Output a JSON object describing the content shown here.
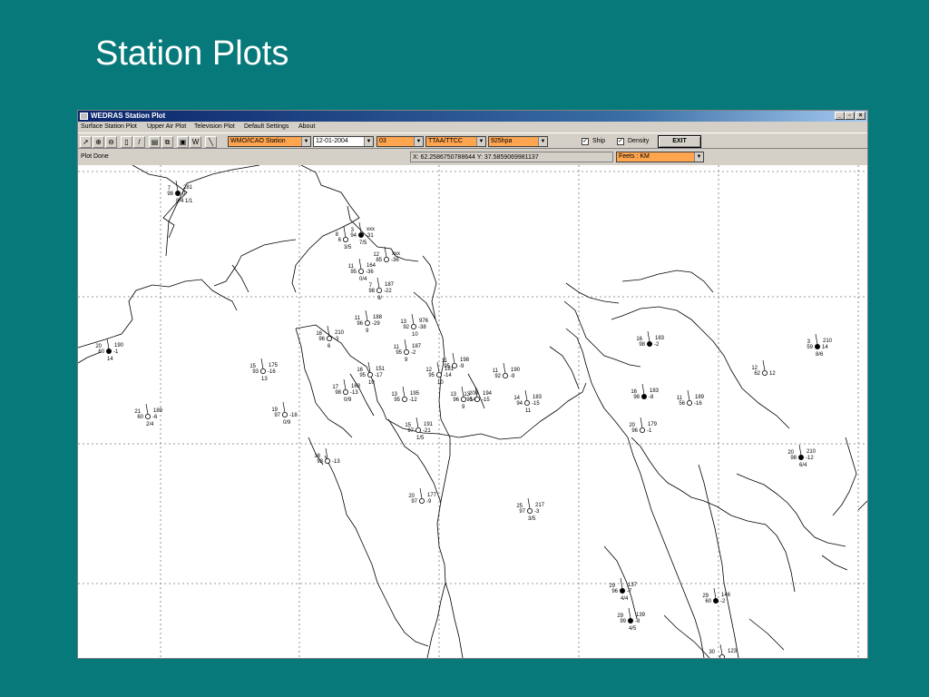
{
  "slide": {
    "title": "Station Plots"
  },
  "window": {
    "title": "WEDRAS Station Plot",
    "controls": [
      "_",
      "▫",
      "×"
    ]
  },
  "menu": [
    "Surface Station Plot",
    "Upper Air Plot",
    "Television Plot",
    "Default Settings",
    "About"
  ],
  "toolbar": {
    "tools": [
      "pointer-icon",
      "zoom-in-icon",
      "zoom-out-icon",
      "lamp-icon",
      "pencil-icon",
      "print-icon",
      "copy-icon",
      "save-icon",
      "w-icon",
      "line-icon"
    ],
    "station_type": "WMO/ICAO Station",
    "date": "12-01-2004",
    "hour": "03",
    "code": "TTAA/TTCC",
    "level": "925hpa",
    "ship_label": "Ship",
    "ship_checked": true,
    "density_label": "Density",
    "density_checked": true,
    "exit_label": "EXIT",
    "highlight_color": "#ffa54f"
  },
  "status": {
    "message": "Plot Done",
    "coords": "X: 62.2586750788644  Y: 37.5859069981137",
    "units": "Feets : KM"
  },
  "map": {
    "stations": [
      {
        "top": "7",
        "left": "98",
        "right": "0",
        "val": "281",
        "low": "8/4 1/1",
        "f": "#"
      },
      {
        "top": "3",
        "left": "94",
        "right": "-31",
        "val": "xxx",
        "low": "7/5",
        "f": "#"
      },
      {
        "top": "8",
        "left": "6",
        "right": "",
        "val": "",
        "low": "3/5",
        "f": "-"
      },
      {
        "top": "12",
        "left": "85",
        "right": "-36",
        "val": "xxx",
        "low": "",
        "f": "o"
      },
      {
        "top": "11",
        "left": "95",
        "right": "-36",
        "val": "164",
        "low": "0/4",
        "f": "o"
      },
      {
        "top": "7",
        "left": "98",
        "right": "-22",
        "val": "187",
        "low": "9/",
        "f": "o"
      },
      {
        "top": "11",
        "left": "96",
        "right": "-29",
        "val": "188",
        "low": "9",
        "f": "o"
      },
      {
        "top": "13",
        "left": "92",
        "right": "-38",
        "val": "976",
        "low": "10",
        "f": "o"
      },
      {
        "top": "16",
        "left": "96",
        "right": "-3",
        "val": "210",
        "low": "6",
        "f": "o"
      },
      {
        "top": "20",
        "left": "60",
        "right": "-1",
        "val": "190",
        "low": "14",
        "f": "#"
      },
      {
        "top": "15",
        "left": "93",
        "right": "-16",
        "val": "175",
        "low": "13",
        "f": "o"
      },
      {
        "top": "16",
        "left": "95",
        "right": "-17",
        "val": "151",
        "low": "10",
        "f": "o"
      },
      {
        "top": "11",
        "left": "95",
        "right": "-2",
        "val": "187",
        "low": "9",
        "f": "o"
      },
      {
        "top": "11",
        "left": "95",
        "right": "-9",
        "val": "198",
        "low": "",
        "f": "o"
      },
      {
        "top": "12",
        "left": "95",
        "right": "-14",
        "val": "181",
        "low": "10",
        "f": "o"
      },
      {
        "top": "11",
        "left": "92",
        "right": "-9",
        "val": "190",
        "low": "",
        "f": "o"
      },
      {
        "top": "17",
        "left": "98",
        "right": "-13",
        "val": "163",
        "low": "0/9",
        "f": "o"
      },
      {
        "top": "13",
        "left": "95",
        "right": "-12",
        "val": "195",
        "low": "",
        "f": "o"
      },
      {
        "top": "13",
        "left": "96",
        "right": "-14",
        "val": "200",
        "low": "9",
        "f": "o"
      },
      {
        "top": "13",
        "left": "95",
        "right": "-15",
        "val": "194",
        "low": "",
        "f": "o"
      },
      {
        "top": "14",
        "left": "94",
        "right": "-15",
        "val": "183",
        "low": "11",
        "f": "o"
      },
      {
        "top": "21",
        "left": "60",
        "right": "-6",
        "val": "189",
        "low": "2/4",
        "f": "o"
      },
      {
        "top": "19",
        "left": "97",
        "right": "-18",
        "val": "",
        "low": "0/9",
        "f": "o"
      },
      {
        "top": "15",
        "left": "97",
        "right": "-21",
        "val": "191",
        "low": "1/5",
        "f": "o"
      },
      {
        "top": "18",
        "left": "93",
        "right": "-13",
        "val": "",
        "low": "",
        "f": "o"
      },
      {
        "top": "20",
        "left": "97",
        "right": "-9",
        "val": "177",
        "low": "",
        "f": "o"
      },
      {
        "top": "25",
        "left": "97",
        "right": "-3",
        "val": "217",
        "low": "3/5",
        "f": "o"
      },
      {
        "top": "16",
        "left": "98",
        "right": "-8",
        "val": "183",
        "low": "",
        "f": "#"
      },
      {
        "top": "20",
        "left": "96",
        "right": "-1",
        "val": "179",
        "low": "",
        "f": "o"
      },
      {
        "top": "20",
        "left": "98",
        "right": "-12",
        "val": "210",
        "low": "6/4",
        "f": "#"
      },
      {
        "top": "3",
        "left": "59",
        "right": "14",
        "val": "210",
        "low": "8/6",
        "f": "#"
      },
      {
        "top": "12",
        "left": "62",
        "right": "12",
        "val": "",
        "low": "",
        "f": "o"
      },
      {
        "top": "16",
        "left": "98",
        "right": "-2",
        "val": "183",
        "low": "",
        "f": "#"
      },
      {
        "top": "11",
        "left": "56",
        "right": "-16",
        "val": "189",
        "low": "",
        "f": "o"
      },
      {
        "top": "29",
        "left": "96",
        "right": "-7",
        "val": "137",
        "low": "4/4",
        "f": "#"
      },
      {
        "top": "29",
        "left": "99",
        "right": "-8",
        "val": "139",
        "low": "4/5",
        "f": "#"
      },
      {
        "top": "29",
        "left": "60",
        "right": "-2",
        "val": "146",
        "low": "",
        "f": "#"
      },
      {
        "top": "30",
        "left": "",
        "right": "",
        "val": "123",
        "low": "6/4",
        "f": "o"
      }
    ]
  }
}
